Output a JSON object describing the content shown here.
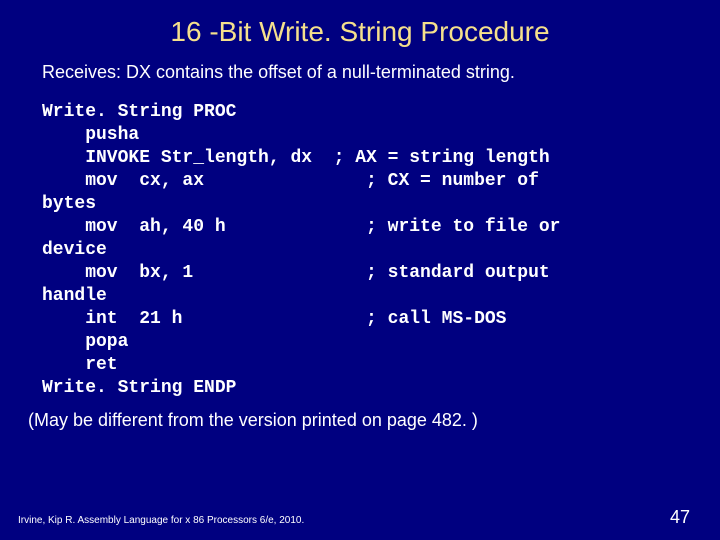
{
  "title": "16 -Bit Write. String Procedure",
  "subtitle": "Receives: DX contains the offset of a null-terminated string.",
  "code": "Write. String PROC\n    pusha\n    INVOKE Str_length, dx  ; AX = string length\n    mov  cx, ax               ; CX = number of\nbytes\n    mov  ah, 40 h             ; write to file or\ndevice\n    mov  bx, 1                ; standard output\nhandle\n    int  21 h                 ; call MS-DOS\n    popa\n    ret\nWrite. String ENDP",
  "note": "(May be different from the version printed on page 482. )",
  "footer": "Irvine, Kip R. Assembly Language for x 86 Processors 6/e, 2010.",
  "page_number": "47"
}
